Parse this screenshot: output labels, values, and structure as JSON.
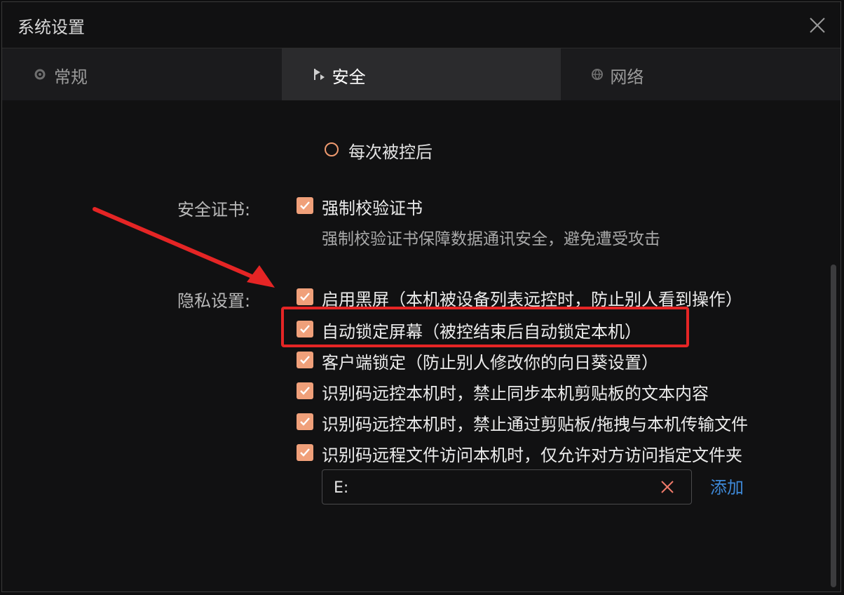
{
  "window": {
    "title": "系统设置"
  },
  "tabs": [
    {
      "label": "常规",
      "icon": "gear-icon",
      "active": false
    },
    {
      "label": "安全",
      "icon": "shield-flag-icon",
      "active": true
    },
    {
      "label": "网络",
      "icon": "globe-icon",
      "active": false
    }
  ],
  "security": {
    "radio_option": "每次被控后",
    "cert_label": "安全证书:",
    "cert_checkbox": "强制校验证书",
    "cert_desc": "强制校验证书保障数据通讯安全，避免遭受攻击",
    "privacy_label": "隐私设置:",
    "privacy_items": [
      "启用黑屏（本机被设备列表远控时，防止别人看到操作）",
      "自动锁定屏幕（被控结束后自动锁定本机）",
      "客户端锁定（防止别人修改你的向日葵设置）",
      "识别码远控本机时，禁止同步本机剪贴板的文本内容",
      "识别码远控本机时，禁止通过剪贴板/拖拽与本机传输文件",
      "识别码远程文件访问本机时，仅允许对方访问指定文件夹"
    ],
    "folder_value": "E:",
    "add_label": "添加"
  },
  "colors": {
    "accent": "#f0a07a",
    "link": "#3e88d6",
    "annotation": "#e52525"
  }
}
